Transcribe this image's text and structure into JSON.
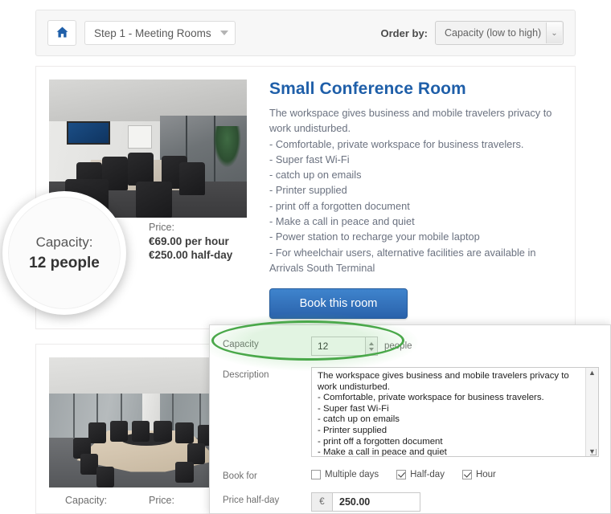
{
  "toolbar": {
    "home_icon": "home-icon",
    "step_select": {
      "value": "Step 1 - Meeting Rooms",
      "caret_icon": "chevron-down-icon"
    },
    "order_by_label": "Order by:",
    "order_by_select": {
      "value": "Capacity (low to high)",
      "arrow_icon": "chevron-down-icon"
    }
  },
  "rooms": [
    {
      "title": "Small Conference Room",
      "photo_name": "small-conference-room-photo",
      "description_lines": [
        "The workspace gives business and mobile travelers privacy to work undisturbed.",
        "- Comfortable, private workspace for business travelers.",
        "- Super fast Wi-Fi",
        "- catch up on emails",
        "- Printer supplied",
        "- print off a forgotten document",
        "- Make a call in peace and quiet",
        "- Power station to recharge your mobile laptop",
        "- For wheelchair users, alternative facilities are available in Arrivals South Terminal"
      ],
      "capacity_heading": "Capacity:",
      "capacity_value": "12 people",
      "price_heading": "Price:",
      "price_hour": "€69.00 per hour",
      "price_halfday": "€250.00 half-day",
      "book_button": "Book this room"
    },
    {
      "title": "",
      "photo_name": "large-conference-room-photo",
      "capacity_heading": "Capacity:",
      "price_heading": "Price:"
    }
  ],
  "magnifier": {
    "label": "Capacity:",
    "value": "12 people"
  },
  "form": {
    "capacity": {
      "label": "Capacity",
      "value": "12",
      "unit": "people",
      "spin_up_icon": "caret-up-icon",
      "spin_down_icon": "caret-down-icon"
    },
    "description": {
      "label": "Description",
      "value": "The workspace gives business and mobile travelers privacy to work undisturbed.\n- Comfortable, private workspace for business travelers.\n- Super fast Wi-Fi\n- catch up on emails\n- Printer supplied\n- print off a forgotten document\n- Make a call in peace and quiet\n- Power station to recharge your mobile laptop\n- For wheelchair users, alternative facilities are available in Arrivals South Terminal",
      "scroll_up_icon": "scroll-up-arrow-icon",
      "scroll_down_icon": "scroll-down-arrow-icon"
    },
    "book_for": {
      "label": "Book for",
      "options": [
        {
          "label": "Multiple days",
          "checked": false
        },
        {
          "label": "Half-day",
          "checked": true
        },
        {
          "label": "Hour",
          "checked": true
        }
      ]
    },
    "price_halfday": {
      "label": "Price half-day",
      "currency": "€",
      "value": "250.00"
    }
  },
  "colors": {
    "title_blue": "#1f5fa9",
    "button_blue": "#2a62ab",
    "highlight_green": "#4aa84a"
  }
}
